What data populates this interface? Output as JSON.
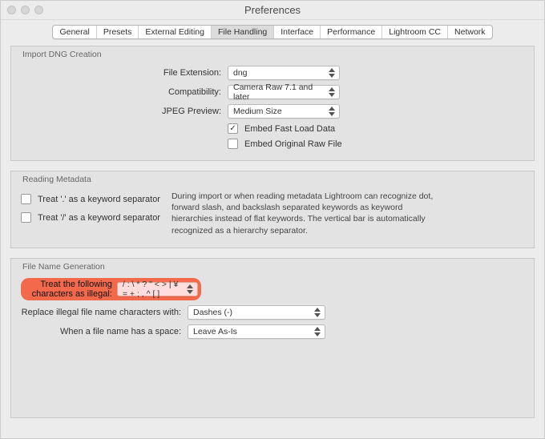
{
  "window": {
    "title": "Preferences"
  },
  "tabs": {
    "items": [
      {
        "label": "General"
      },
      {
        "label": "Presets"
      },
      {
        "label": "External Editing"
      },
      {
        "label": "File Handling"
      },
      {
        "label": "Interface"
      },
      {
        "label": "Performance"
      },
      {
        "label": "Lightroom CC"
      },
      {
        "label": "Network"
      }
    ],
    "active_index": 3
  },
  "panels": {
    "dng": {
      "legend": "Import DNG Creation",
      "file_ext_label": "File Extension:",
      "file_ext_value": "dng",
      "compat_label": "Compatibility:",
      "compat_value": "Camera Raw 7.1 and later",
      "jpeg_label": "JPEG Preview:",
      "jpeg_value": "Medium Size",
      "fastload_label": "Embed Fast Load Data",
      "fastload_checked": true,
      "original_label": "Embed Original Raw File",
      "original_checked": false
    },
    "meta": {
      "legend": "Reading Metadata",
      "sep_dot_label": "Treat '.' as a keyword separator",
      "sep_slash_label": "Treat '/' as a keyword separator",
      "help": "During import or when reading metadata Lightroom can recognize dot, forward slash, and backslash separated keywords as keyword hierarchies instead of flat keywords. The vertical bar is automatically recognized as a hierarchy separator."
    },
    "filenames": {
      "legend": "File Name Generation",
      "illegal_label": "Treat the following characters as illegal:",
      "illegal_value": "/ : \\ * ? \" < > | ¥ = + ; , ^ [ ]",
      "replace_label": "Replace illegal file name characters with:",
      "replace_value": "Dashes (-)",
      "space_label": "When a file name has a space:",
      "space_value": "Leave As-Is"
    }
  }
}
